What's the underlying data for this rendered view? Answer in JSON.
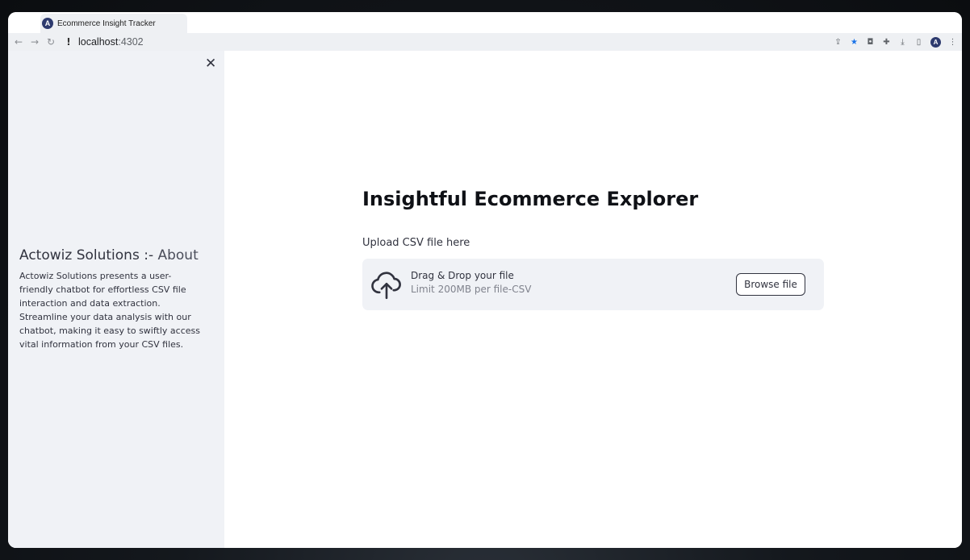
{
  "browser": {
    "tab_title": "Ecommerce Insight Tracker",
    "favicon_letter": "A",
    "url_host": "localhost",
    "url_port": ":4302",
    "profile_letter": "A",
    "icons": [
      "back-arrow-icon",
      "forward-arrow-icon",
      "reload-icon",
      "info-icon",
      "share-icon",
      "star-icon",
      "screenshot-icon",
      "extensions-icon",
      "download-icon",
      "side-panel-icon",
      "avatar-icon",
      "menu-icon"
    ]
  },
  "sidebar": {
    "close_label": "✕",
    "about_title_bold": "Actowiz Solutions :-",
    "about_title_light": "About",
    "about_text": "Actowiz Solutions presents a user-friendly chatbot for effortless CSV file interaction and data extraction. Streamline your data analysis with our chatbot, making it easy to swiftly access vital information from your CSV files."
  },
  "main": {
    "title": "Insightful Ecommerce Explorer",
    "upload_label": "Upload CSV file here",
    "dropzone": {
      "primary": "Drag & Drop your file",
      "secondary": "Limit 200MB per file-CSV",
      "browse_label": "Browse file"
    }
  },
  "colors": {
    "sidebar_bg": "#f0f2f6",
    "text": "#31333f",
    "accent_star": "#1a73e8"
  }
}
